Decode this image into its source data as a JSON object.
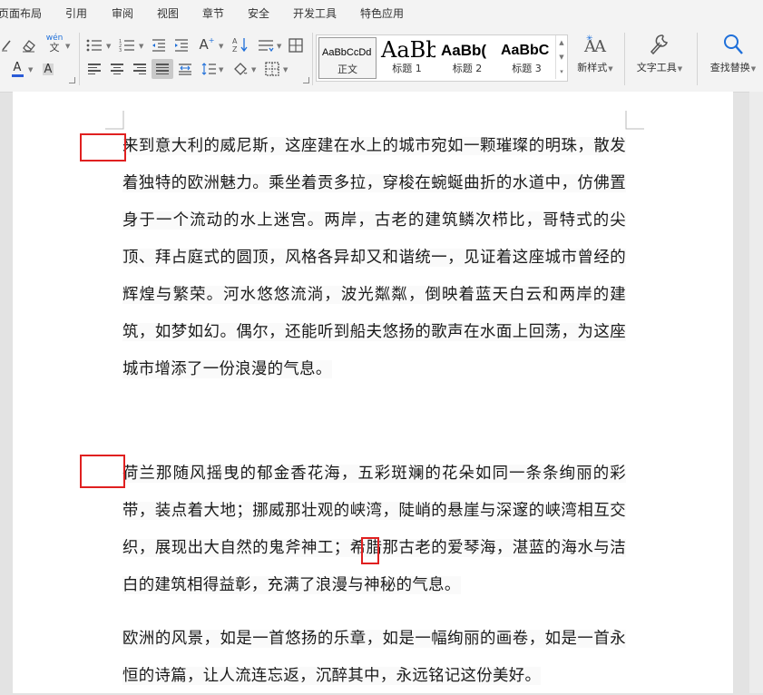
{
  "menubar": {
    "items": [
      "页面布局",
      "引用",
      "审阅",
      "视图",
      "章节",
      "安全",
      "开发工具",
      "特色应用"
    ]
  },
  "ribbon": {
    "font": {
      "phonetic_label": "wén",
      "font_color_letter": "A",
      "char_shade_letter": "A"
    },
    "paragraph": {
      "change_case_letter": "A"
    },
    "styles": [
      {
        "sample": "AaBbCcDd",
        "name": "正文"
      },
      {
        "sample": "AaBb",
        "name": "标题 1"
      },
      {
        "sample": "AaBb(",
        "name": "标题 2"
      },
      {
        "sample": "AaBbC",
        "name": "标题 3"
      }
    ],
    "new_style": {
      "sample": "AA",
      "label": "新样式"
    },
    "text_tools": {
      "label": "文字工具"
    },
    "find_replace": {
      "label": "查找替换"
    }
  },
  "document": {
    "paragraphs": [
      "来到意大利的威尼斯，这座建在水上的城市宛如一颗璀璨的明珠，散发着独特的欧洲魅力。乘坐着贡多拉，穿梭在蜿蜒曲折的水道中，仿佛置身于一个流动的水上迷宫。两岸，古老的建筑鳞次栉比，哥特式的尖顶、拜占庭式的圆顶，风格各异却又和谐统一，见证着这座城市曾经的辉煌与繁荣。河水悠悠流淌，波光粼粼，倒映着蓝天白云和两岸的建筑，如梦如幻。偶尔，还能听到船夫悠扬的歌声在水面上回荡，为这座城市增添了一份浪漫的气息。",
      "荷兰那随风摇曳的郁金香花海，五彩斑斓的花朵如同一条条绚丽的彩带，装点着大地；挪威那壮观的峡湾，陡峭的悬崖与深邃的峡湾相互交织，展现出大自然的鬼斧神工；希腊那古老的爱琴海，湛蓝的海水与洁白的建筑相得益彰，充满了浪漫与神秘的气息。",
      "欧洲的风景，如是一首悠扬的乐章，如是一幅绚丽的画卷，如是一首永恒的诗篇，让人流连忘返，沉醉其中，永远铭记这份美好。"
    ]
  },
  "colors": {
    "highlight_box": "#e02020",
    "font_color_underline": "#2a5bd7",
    "accent": "#1e6fd9"
  }
}
